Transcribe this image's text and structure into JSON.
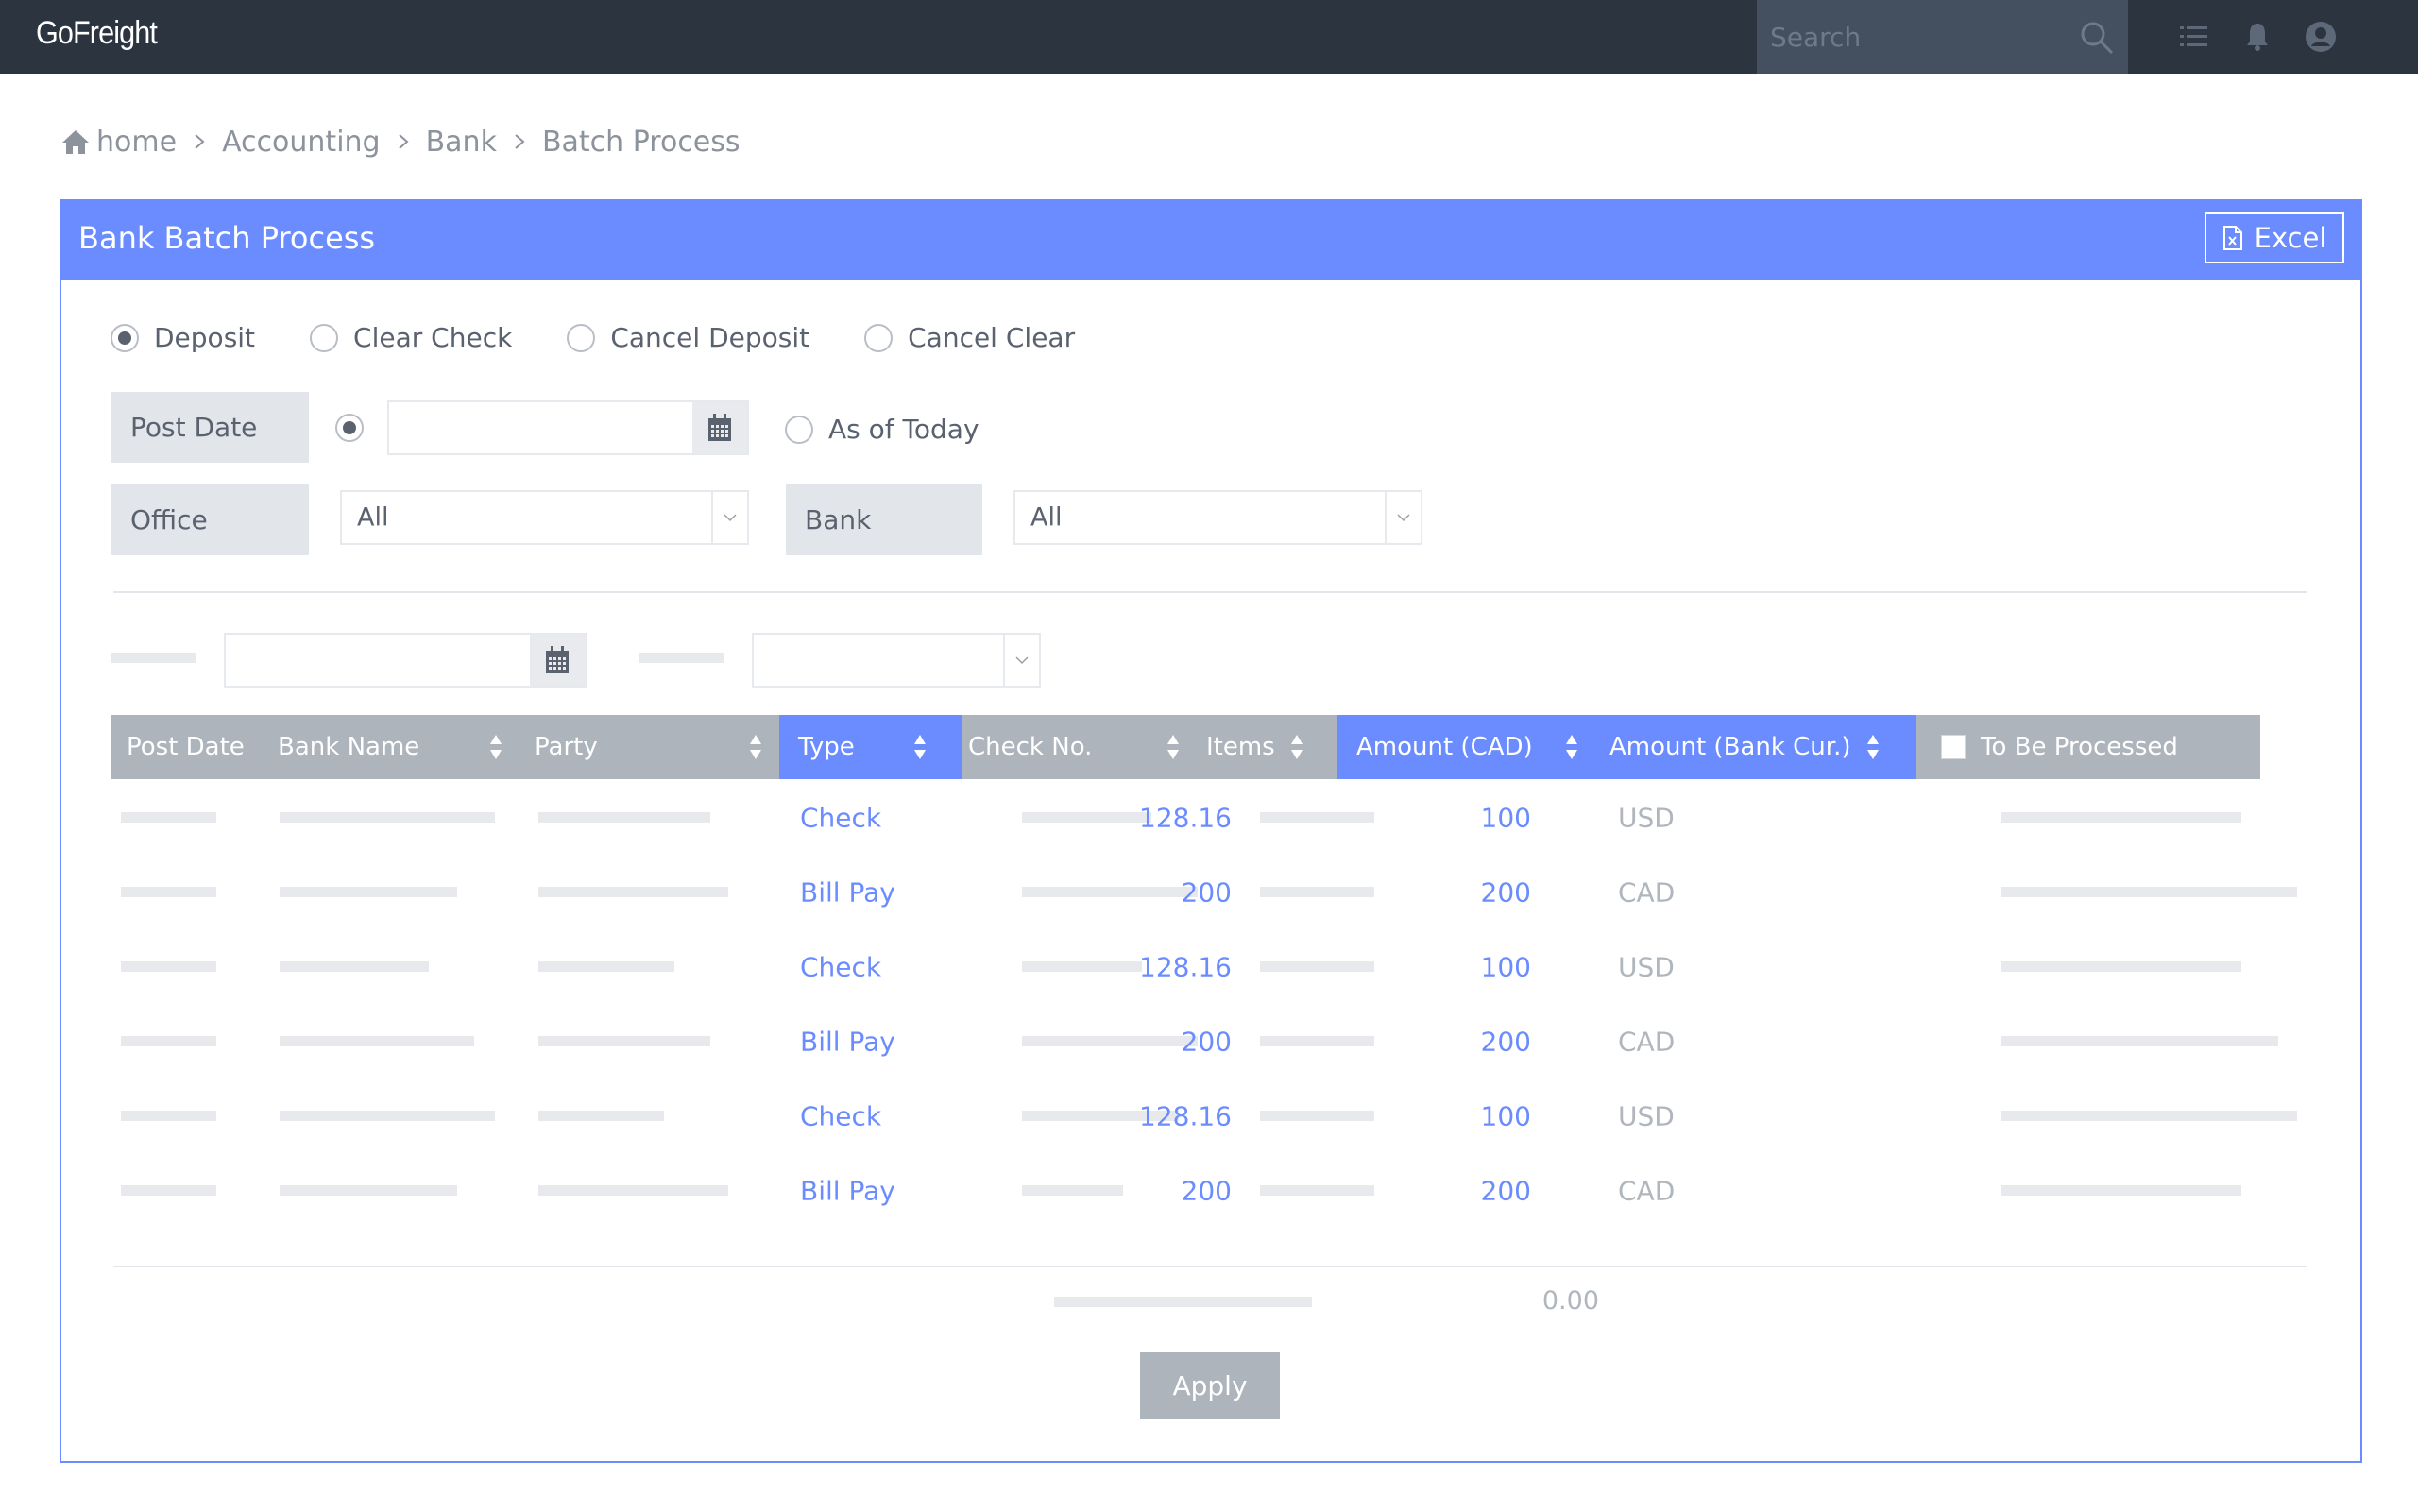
{
  "app": {
    "logo": "GoFreight",
    "search_placeholder": "Search"
  },
  "breadcrumb": [
    "home",
    "Accounting",
    "Bank",
    "Batch Process"
  ],
  "panel": {
    "title": "Bank Batch Process",
    "excel_label": "Excel"
  },
  "mode_options": [
    {
      "label": "Deposit",
      "checked": true
    },
    {
      "label": "Clear Check",
      "checked": false
    },
    {
      "label": "Cancel Deposit",
      "checked": false
    },
    {
      "label": "Cancel Clear",
      "checked": false
    }
  ],
  "filters": {
    "post_date_label": "Post Date",
    "post_date_value": "",
    "post_date_mode_selected": "date",
    "as_of_today_label": "As of Today",
    "office_label": "Office",
    "office_value": "All",
    "bank_label": "Bank",
    "bank_value": "All"
  },
  "secondary_filters": {
    "date_value": "",
    "select_value": ""
  },
  "table": {
    "columns": [
      {
        "label": "Post Date",
        "sortable": false,
        "highlighted": false
      },
      {
        "label": "Bank Name",
        "sortable": true,
        "highlighted": false
      },
      {
        "label": "Party",
        "sortable": true,
        "highlighted": false
      },
      {
        "label": "Type",
        "sortable": true,
        "highlighted": true
      },
      {
        "label": "Check No.",
        "sortable": true,
        "highlighted": false
      },
      {
        "label": "Items",
        "sortable": true,
        "highlighted": false
      },
      {
        "label": "Amount (CAD)",
        "sortable": true,
        "highlighted": true
      },
      {
        "label": "Amount (Bank Cur.)",
        "sortable": true,
        "highlighted": true
      },
      {
        "label": "To Be Processed",
        "sortable": false,
        "highlighted": false
      }
    ],
    "select_all_checked": false,
    "rows": [
      {
        "type": "Check",
        "amount_cad": "128.16",
        "currency": "USD",
        "amount_bank": "100"
      },
      {
        "type": "Bill Pay",
        "amount_cad": "200",
        "currency": "CAD",
        "amount_bank": "200"
      },
      {
        "type": "Check",
        "amount_cad": "128.16",
        "currency": "USD",
        "amount_bank": "100"
      },
      {
        "type": "Bill Pay",
        "amount_cad": "200",
        "currency": "CAD",
        "amount_bank": "200"
      },
      {
        "type": "Check",
        "amount_cad": "128.16",
        "currency": "USD",
        "amount_bank": "100"
      },
      {
        "type": "Bill Pay",
        "amount_cad": "200",
        "currency": "CAD",
        "amount_bank": "200"
      }
    ],
    "total_amount": "0.00"
  },
  "actions": {
    "apply_label": "Apply"
  },
  "colors": {
    "nav_bg": "#2c3440",
    "accent": "#6b8cff",
    "header_gray": "#adb4bc",
    "placeholder_bar": "#e7e9ed"
  }
}
